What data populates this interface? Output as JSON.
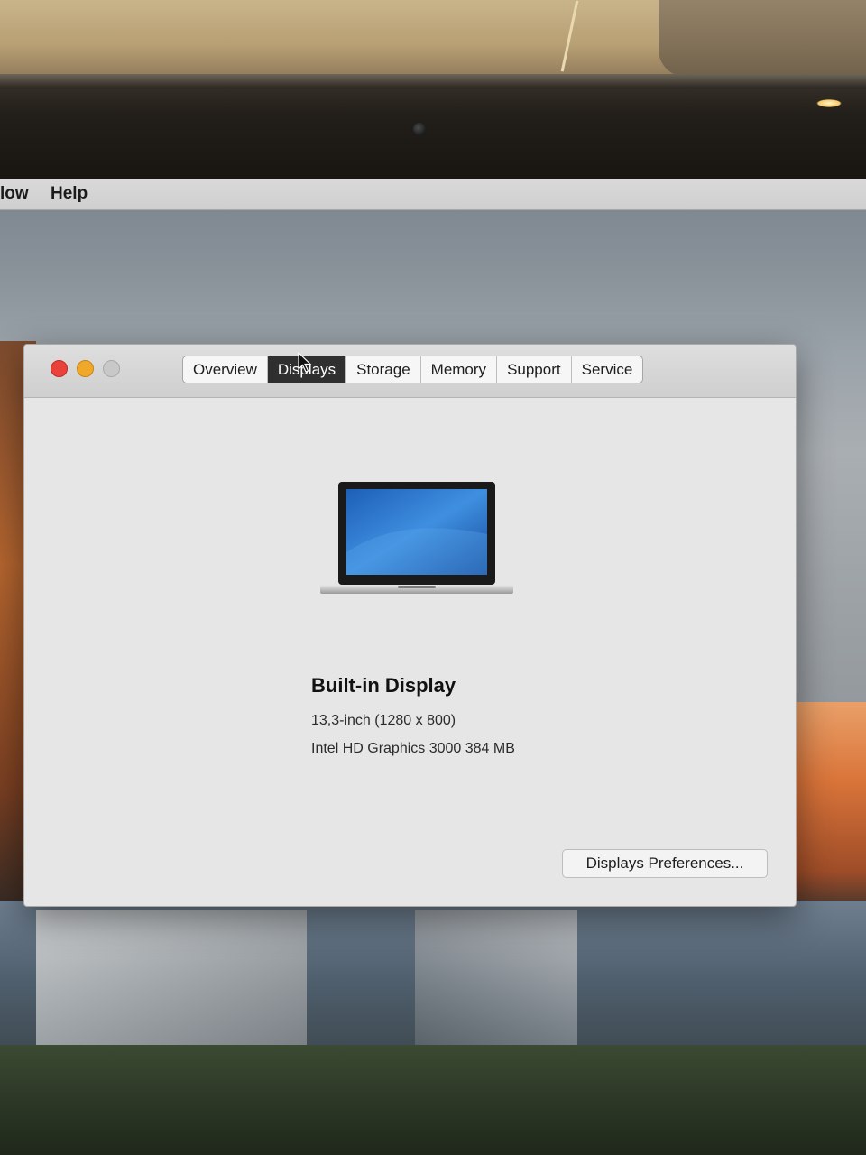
{
  "menubar": {
    "items": [
      "low",
      "Help"
    ]
  },
  "window": {
    "tabs": [
      {
        "label": "Overview",
        "active": false
      },
      {
        "label": "Displays",
        "active": true
      },
      {
        "label": "Storage",
        "active": false
      },
      {
        "label": "Memory",
        "active": false
      },
      {
        "label": "Support",
        "active": false
      },
      {
        "label": "Service",
        "active": false
      }
    ],
    "display": {
      "name": "Built-in Display",
      "size": "13,3-inch (1280 x 800)",
      "graphics": "Intel HD Graphics 3000 384 MB"
    },
    "preferences_button": "Displays Preferences..."
  },
  "colors": {
    "close": "#e9423b",
    "minimize": "#f0a82a",
    "zoom": "#c8c8c8",
    "active_tab": "#2f2f2f"
  }
}
